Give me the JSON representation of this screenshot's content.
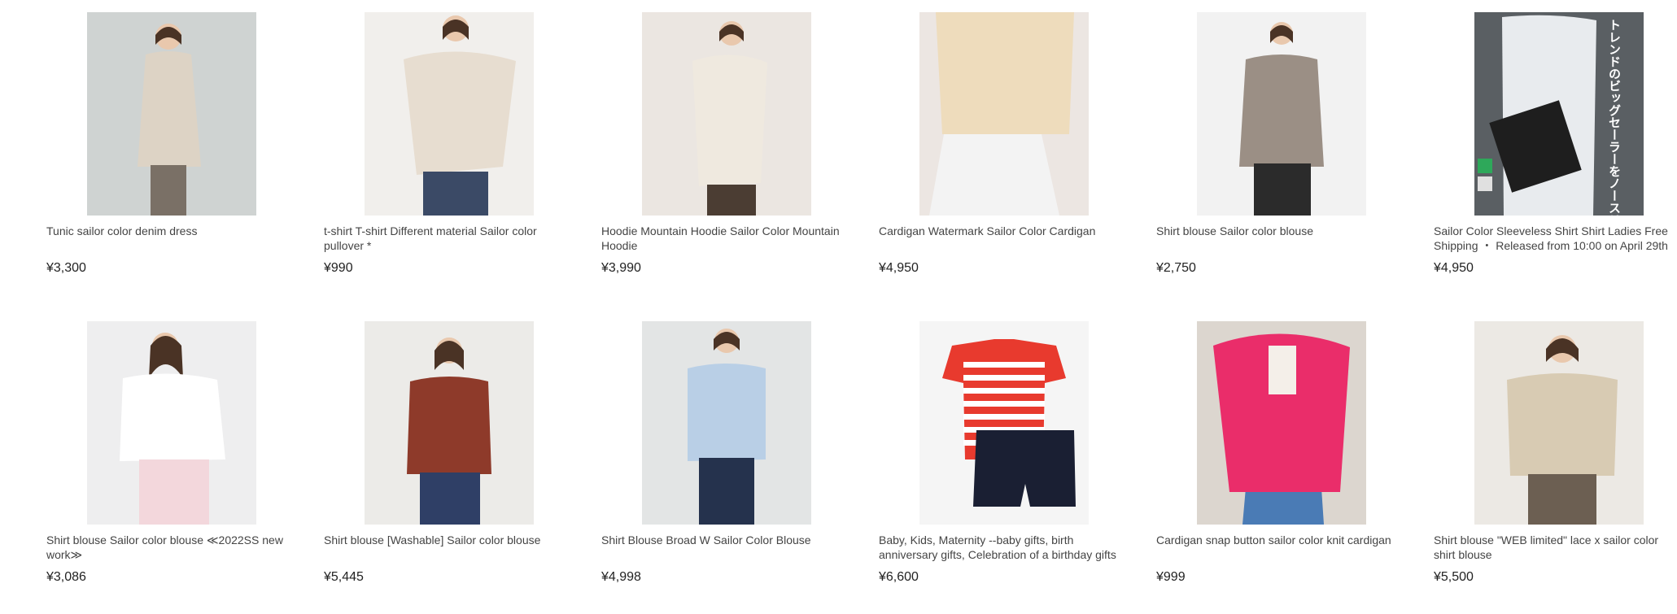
{
  "products": [
    {
      "title": "Tunic sailor color denim dress",
      "price": "¥3,300",
      "colors": {
        "bg": "#cfd3d2",
        "garment": "#ddd3c5",
        "legs": "#7a7066"
      }
    },
    {
      "title": "t-shirt T-shirt Different material Sailor color pullover *",
      "price": "¥990",
      "colors": {
        "bg": "#f1efec",
        "garment": "#e7ddd0",
        "legs": "#3b4a66"
      }
    },
    {
      "title": "Hoodie Mountain Hoodie Sailor Color Mountain Hoodie",
      "price": "¥3,990",
      "colors": {
        "bg": "#ebe6e1",
        "garment": "#efe9df",
        "legs": "#4b3d33"
      }
    },
    {
      "title": "Cardigan Watermark Sailor Color Cardigan",
      "price": "¥4,950",
      "colors": {
        "bg": "#ece6e2",
        "garment": "#eedcbc",
        "legs": "#f3f3f3"
      }
    },
    {
      "title": "Shirt blouse Sailor color blouse",
      "price": "¥2,750",
      "colors": {
        "bg": "#f2f2f2",
        "garment": "#9b8f85",
        "legs": "#2b2b2b"
      }
    },
    {
      "title": "Sailor Color Sleeveless Shirt Shirt Ladies Free Shipping ・ Released from 10:00 on April 29th",
      "price": "¥4,950",
      "colors": {
        "bg": "#5a5f63",
        "garment": "#e8ebee",
        "legs": "#1e1e1e"
      },
      "overlay_text": "トレンドのビッグセーラーをノースリーブで 気になる二の腕カバー×小顔効果"
    },
    {
      "title": "Shirt blouse Sailor color blouse ≪2022SS new work≫",
      "price": "¥3,086",
      "colors": {
        "bg": "#eeeeef",
        "garment": "#ffffff",
        "legs": "#f3d7dc"
      }
    },
    {
      "title": "Shirt blouse [Washable] Sailor color blouse",
      "price": "¥5,445",
      "colors": {
        "bg": "#ecebe8",
        "garment": "#8e3a2a",
        "legs": "#2f3f66"
      }
    },
    {
      "title": "Shirt Blouse Broad W Sailor Color Blouse",
      "price": "¥4,998",
      "colors": {
        "bg": "#e3e5e5",
        "garment": "#b9cfe6",
        "legs": "#25324d"
      }
    },
    {
      "title": "Baby, Kids, Maternity --baby gifts, birth anniversary gifts, Celebration of a birthday gifts",
      "price": "¥6,600",
      "colors": {
        "bg": "#f5f5f5",
        "garment": "#e83a2e",
        "legs": "#1a1f33"
      }
    },
    {
      "title": "Cardigan snap button sailor color knit cardigan",
      "price": "¥999",
      "colors": {
        "bg": "#dcd6cf",
        "garment": "#ea2d6a",
        "legs": "#4a7bb5"
      }
    },
    {
      "title": "Shirt blouse \"WEB limited\" lace x sailor color shirt blouse",
      "price": "¥5,500",
      "colors": {
        "bg": "#ece9e4",
        "garment": "#d8cbb3",
        "legs": "#6c5f52"
      }
    }
  ]
}
